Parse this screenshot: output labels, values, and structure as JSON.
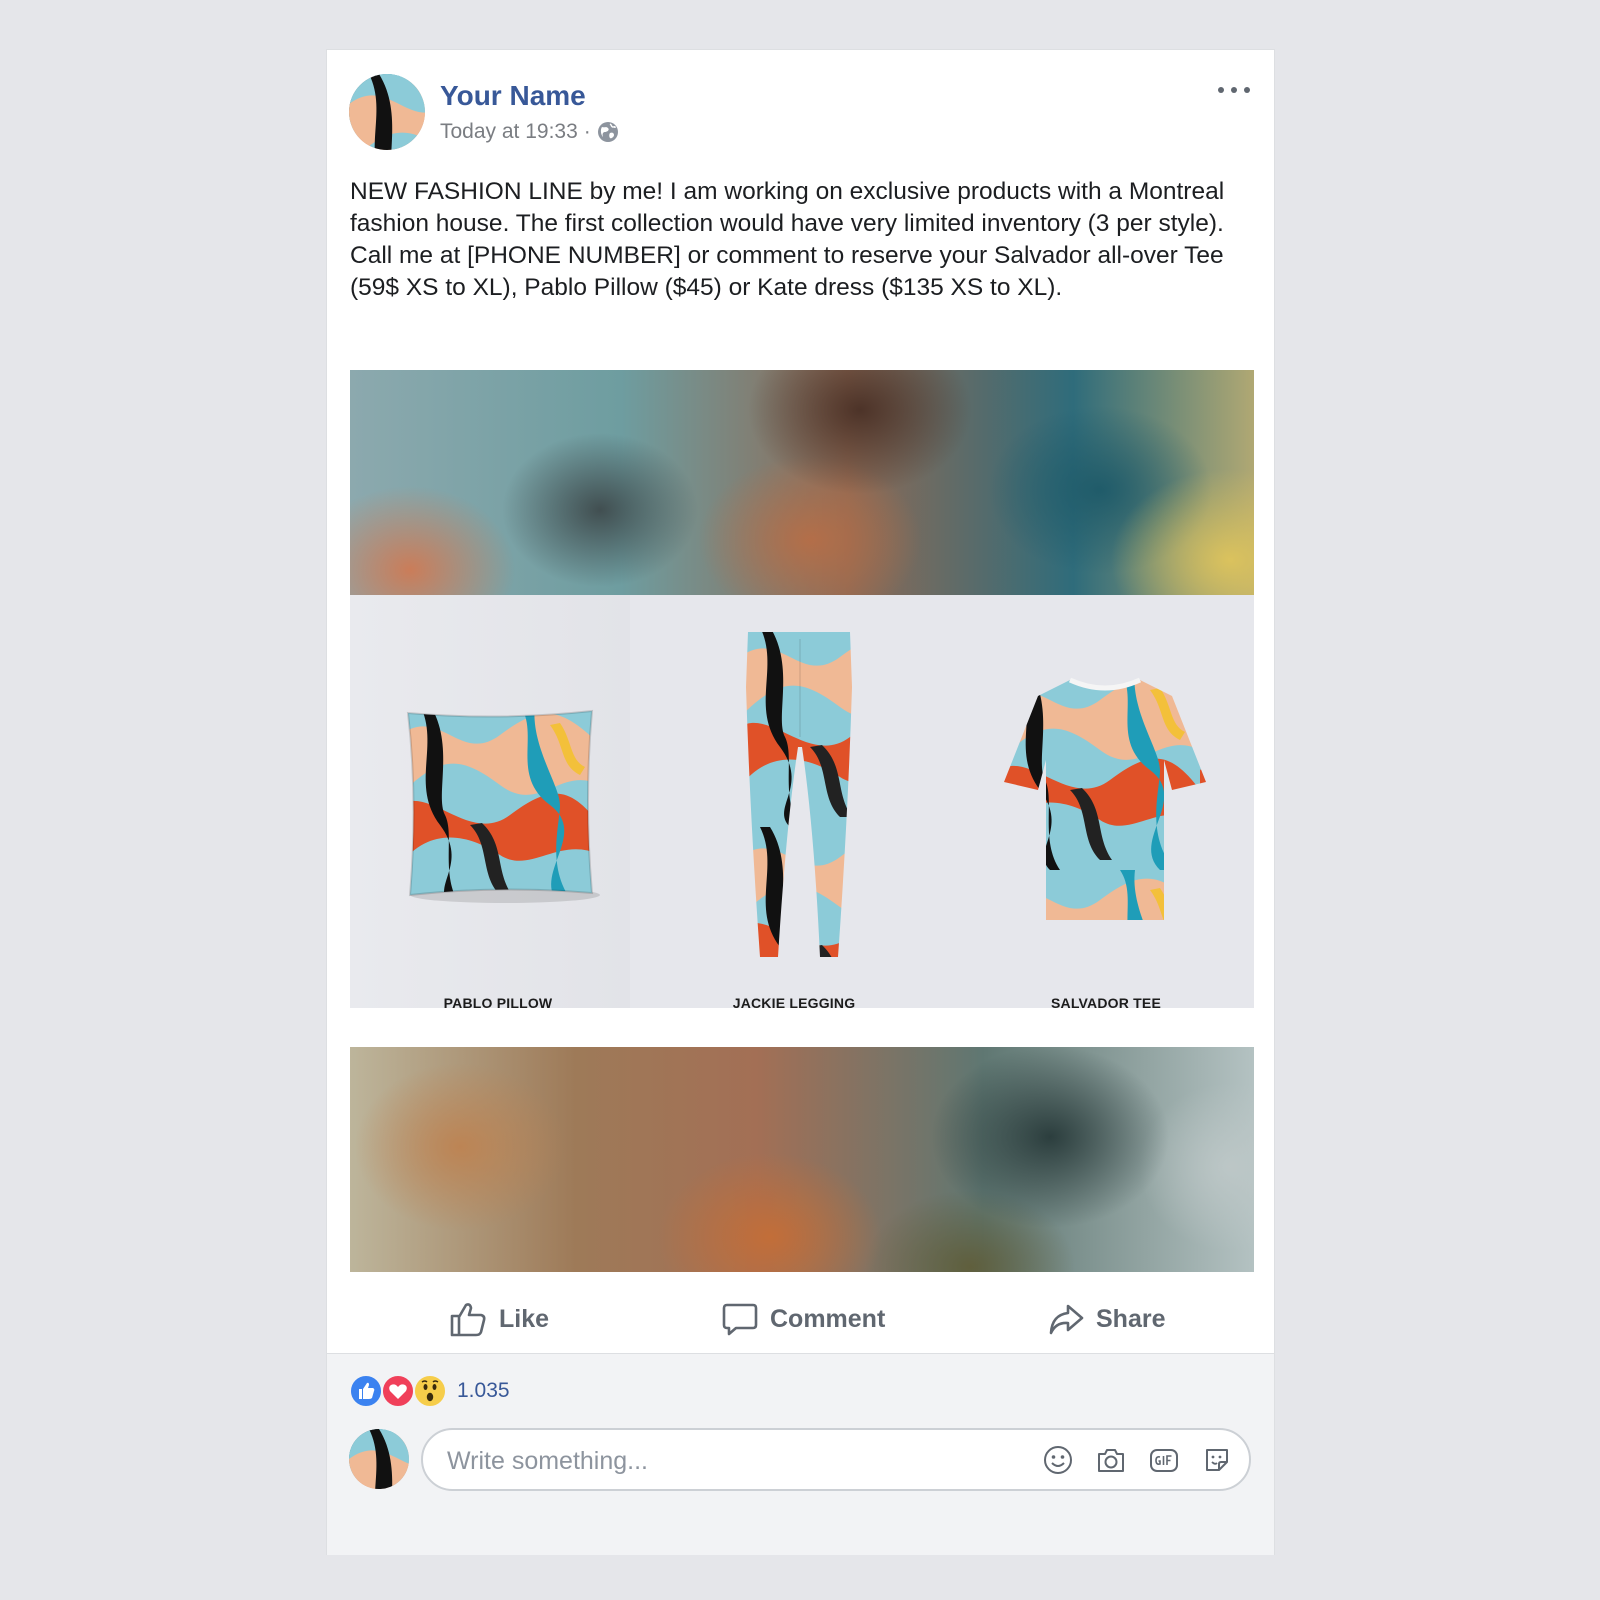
{
  "post": {
    "author": "Your Name",
    "timestamp": "Today at 19:33",
    "separator": "·",
    "audience_icon": "globe-icon",
    "text": "NEW FASHION LINE by me!  I am working on exclusive products with a Montreal fashion house. The first collection would have very limited inventory (3 per style). Call me at [PHONE NUMBER] or comment to reserve your Salvador all-over Tee (59$ XS to XL), Pablo Pillow ($45) or Kate dress ($135 XS to XL).",
    "products": [
      {
        "label": "PABLO PILLOW",
        "icon": "pillow-image"
      },
      {
        "label": "JACKIE LEGGING",
        "icon": "legging-image"
      },
      {
        "label": "SALVADOR TEE",
        "icon": "tee-image"
      }
    ]
  },
  "actions": {
    "like": "Like",
    "comment": "Comment",
    "share": "Share"
  },
  "footer": {
    "reaction_count": "1.035",
    "reactions": [
      "like-reaction-icon",
      "love-reaction-icon",
      "wow-reaction-icon"
    ],
    "comment_placeholder": "Write something...",
    "comment_icons": [
      "emoji-icon",
      "camera-icon",
      "gif-icon",
      "sticker-icon"
    ]
  },
  "colors": {
    "link_blue": "#385898",
    "secondary_text": "#606770",
    "background": "#e5e6ea"
  }
}
